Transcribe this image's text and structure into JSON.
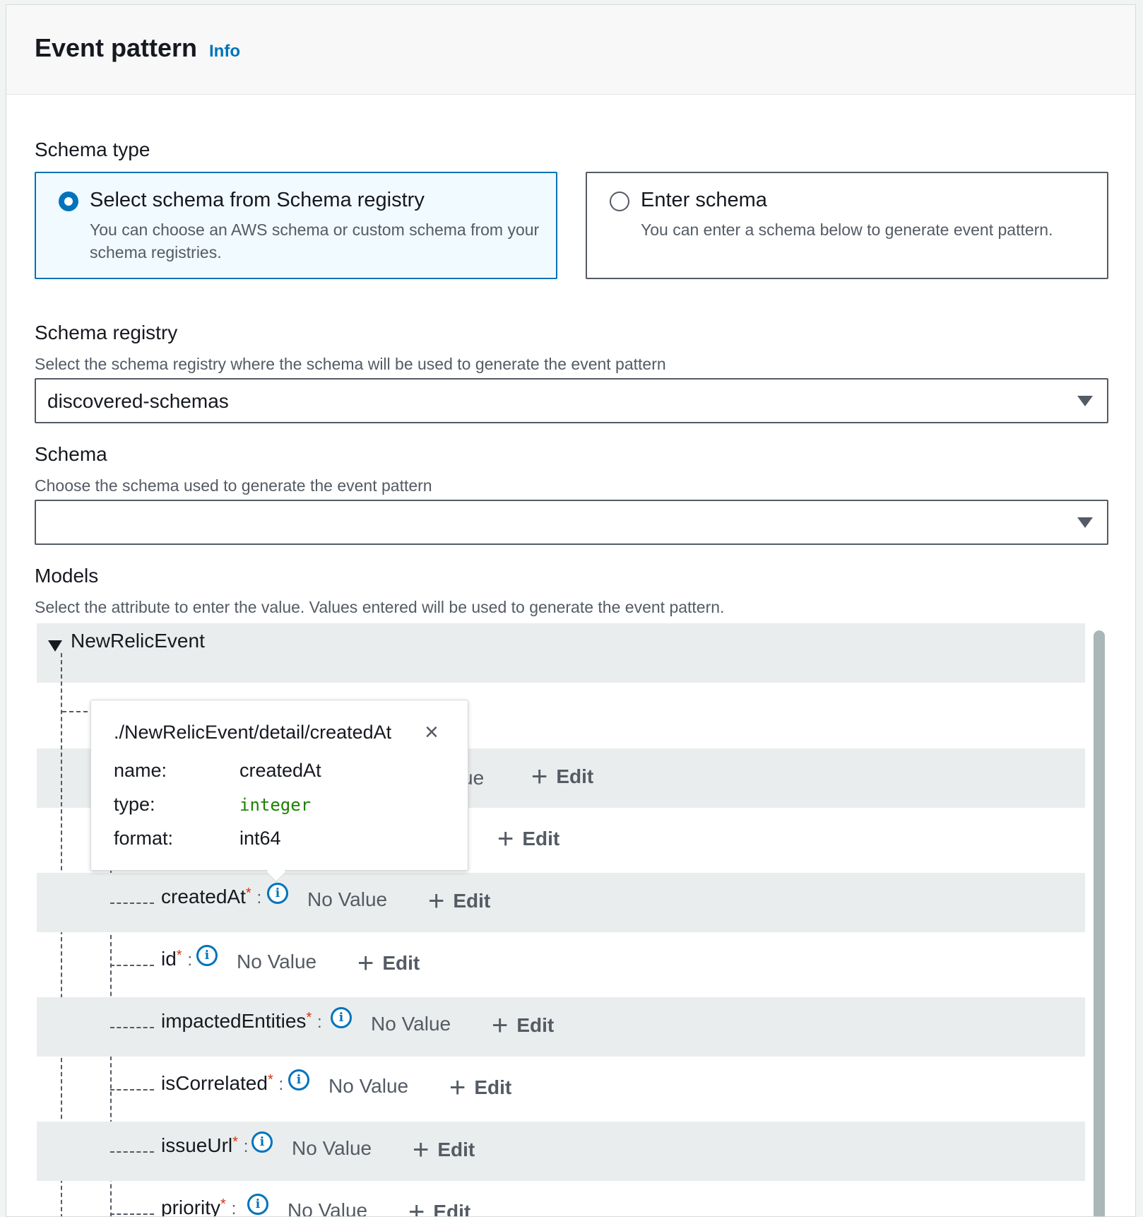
{
  "panel": {
    "title": "Event pattern",
    "info_link": "Info"
  },
  "schema_type": {
    "label": "Schema type",
    "options": [
      {
        "title": "Select schema from Schema registry",
        "description": "You can choose an AWS schema or custom schema from your schema registries.",
        "selected": true
      },
      {
        "title": "Enter schema",
        "description": "You can enter a schema below to generate event pattern.",
        "selected": false
      }
    ]
  },
  "schema_registry": {
    "label": "Schema registry",
    "description": "Select the schema registry where the schema will be used to generate the event pattern",
    "value": "discovered-schemas"
  },
  "schema": {
    "label": "Schema",
    "description": "Choose the schema used to generate the event pattern",
    "value": ""
  },
  "models": {
    "label": "Models",
    "description": "Select the attribute to enter the value. Values entered will be used to generate the event pattern.",
    "root": "NewRelicEvent",
    "partial_value_text": "ue",
    "edit_label": "Edit",
    "required_mark": "*",
    "colon": ":",
    "info_glyph": "i",
    "attributes": [
      {
        "name": "createdAt",
        "value": "No Value"
      },
      {
        "name": "id",
        "value": "No Value"
      },
      {
        "name": "impactedEntities",
        "value": "No Value"
      },
      {
        "name": "isCorrelated",
        "value": "No Value"
      },
      {
        "name": "issueUrl",
        "value": "No Value"
      },
      {
        "name": "priority",
        "value": "No Value"
      }
    ]
  },
  "popover": {
    "path": "./NewRelicEvent/detail/createdAt",
    "close_icon": "×",
    "fields": [
      {
        "key": "name:",
        "value": "createdAt"
      },
      {
        "key": "type:",
        "value": "integer"
      },
      {
        "key": "format:",
        "value": "int64"
      }
    ]
  },
  "colors": {
    "accent": "#0073bb",
    "required": "#d13212",
    "type_code": "#1d8102"
  }
}
